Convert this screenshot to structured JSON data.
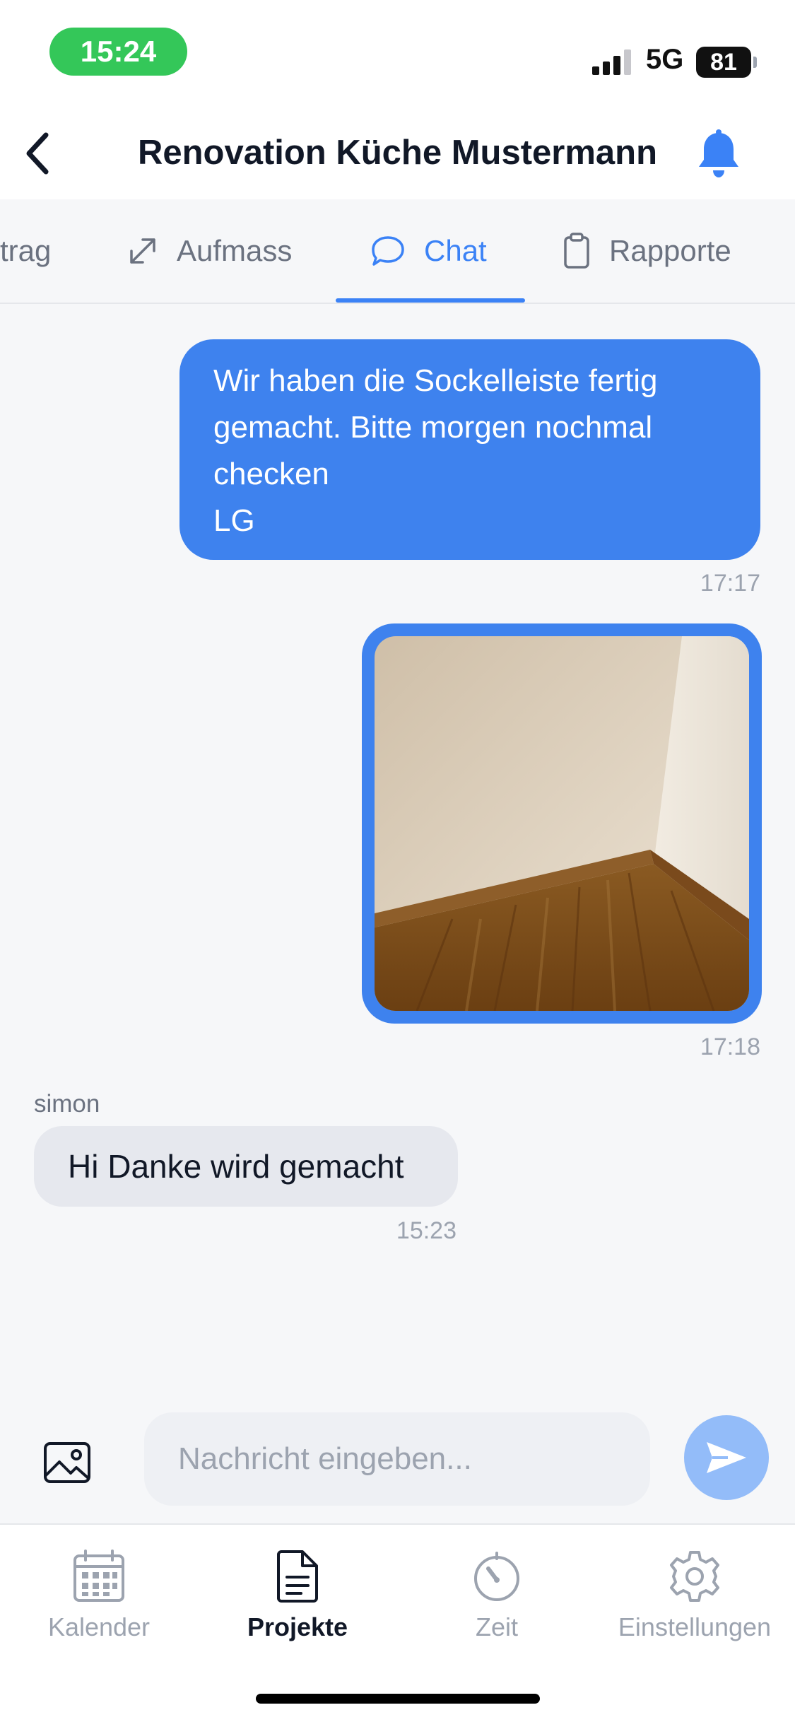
{
  "status_bar": {
    "time": "15:24",
    "network": "5G",
    "battery": "81"
  },
  "header": {
    "title": "Renovation Küche Mustermann",
    "back_icon": "chevron-left-icon",
    "notification_icon": "bell-icon"
  },
  "tabs": [
    {
      "label": "trag",
      "icon": "none",
      "active": false
    },
    {
      "label": "Aufmass",
      "icon": "resize-arrow-icon",
      "active": false
    },
    {
      "label": "Chat",
      "icon": "chat-bubble-icon",
      "active": true
    },
    {
      "label": "Rapporte",
      "icon": "clipboard-icon",
      "active": false
    }
  ],
  "messages": {
    "m1": {
      "direction": "outgoing",
      "lines": [
        "Wir haben die Sockelleiste fertig",
        "gemacht. Bitte morgen nochmal",
        "checken",
        "LG"
      ],
      "time": "17:17"
    },
    "m2": {
      "direction": "outgoing",
      "type": "image",
      "time": "17:18"
    },
    "m3": {
      "direction": "incoming",
      "sender": "simon",
      "text": "Hi Danke wird gemacht",
      "time": "15:23"
    }
  },
  "composer": {
    "placeholder": "Nachricht eingeben...",
    "value": "",
    "attach_icon": "image-icon",
    "send_icon": "send-icon"
  },
  "bottom_nav": [
    {
      "label": "Kalender",
      "icon": "calendar-icon",
      "active": false
    },
    {
      "label": "Projekte",
      "icon": "document-icon",
      "active": true
    },
    {
      "label": "Zeit",
      "icon": "timer-icon",
      "active": false
    },
    {
      "label": "Einstellungen",
      "icon": "gear-icon",
      "active": false
    }
  ],
  "colors": {
    "accent": "#3b82f6",
    "outgoing_bubble": "#3e82ee",
    "incoming_bubble": "#e6e8ee",
    "status_pill": "#34c759"
  }
}
